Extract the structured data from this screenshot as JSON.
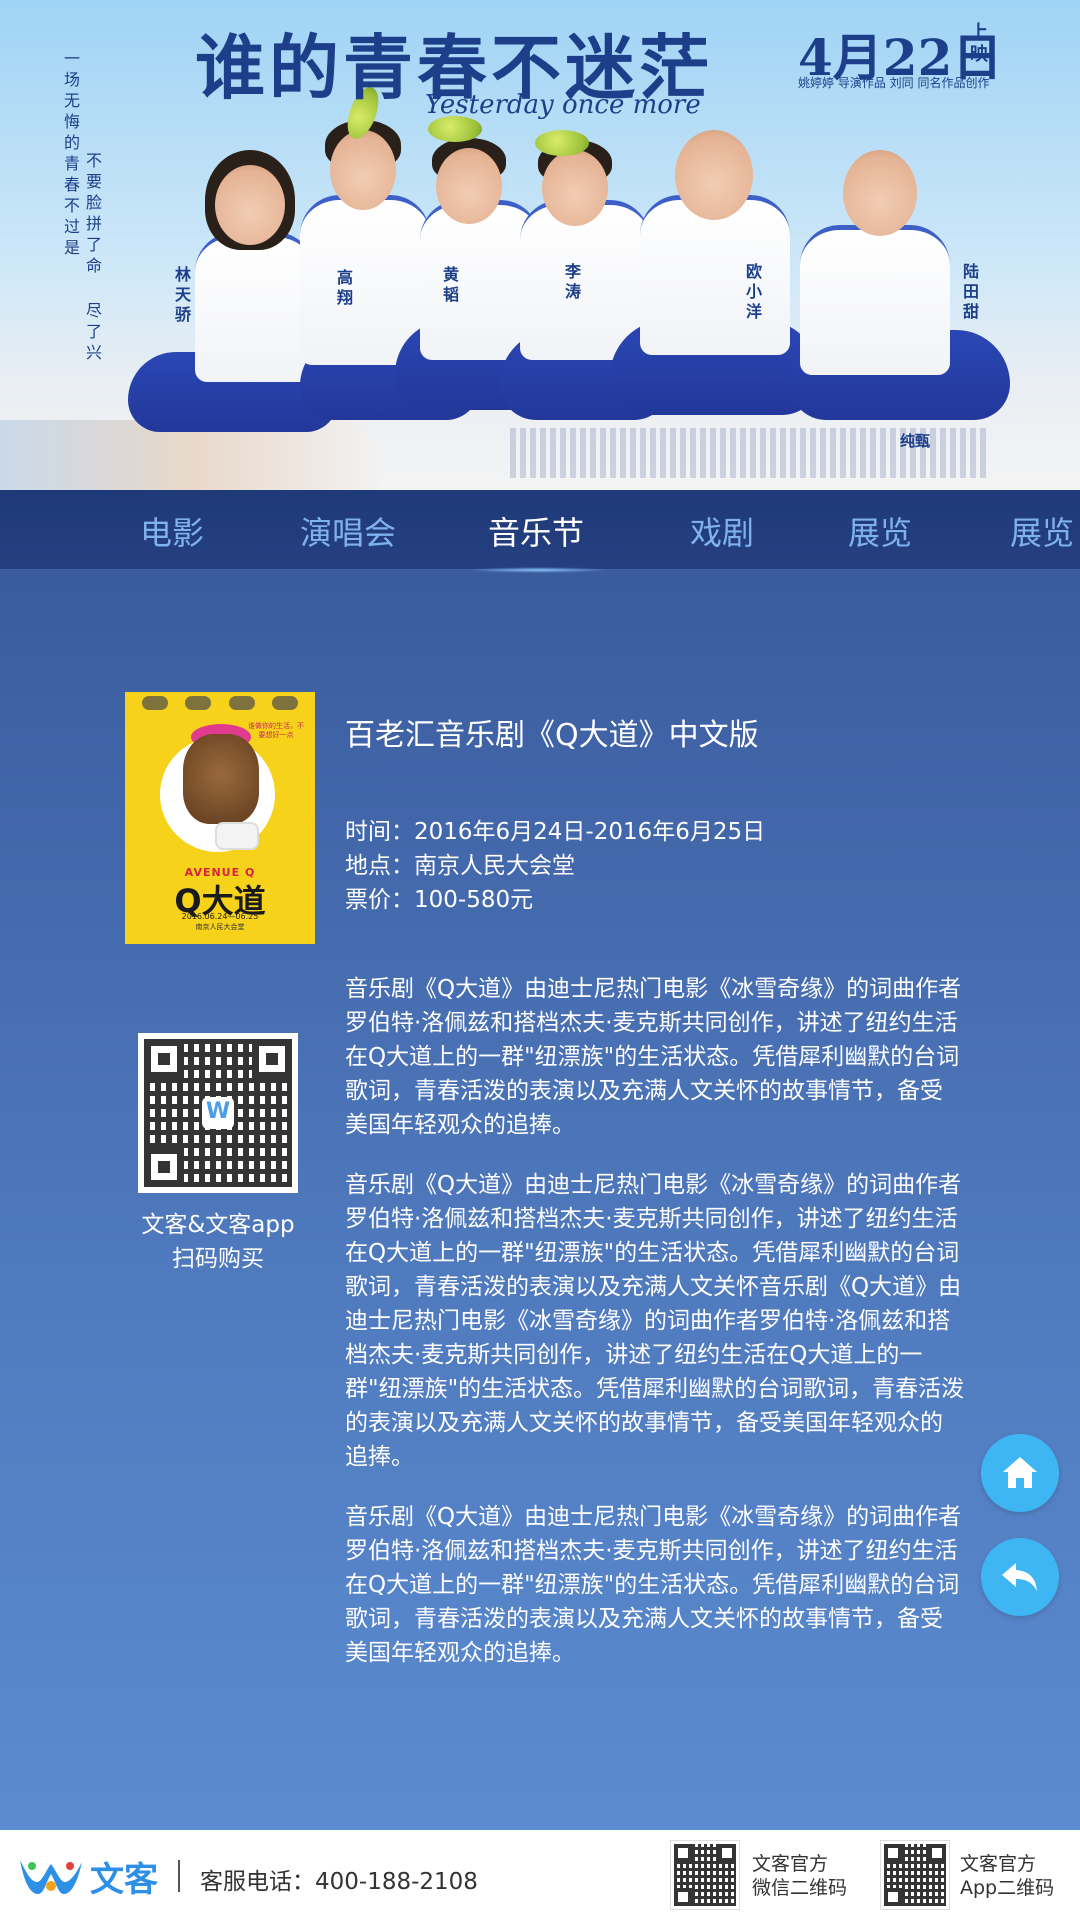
{
  "banner": {
    "title": "谁的青春不迷茫",
    "subtitle": "Yesterday once more",
    "date": "4月22日",
    "date_suffix": "上映",
    "credits": "姚婷婷 导演作品  刘同 同名作品创作",
    "tagline_right": "一场无悔的青春不过是",
    "tagline_mid": "不要脸拼了命",
    "tagline_left": "尽了兴",
    "characters": [
      "林天骄",
      "高翔",
      "黄韬",
      "李涛",
      "欧小洋",
      "陆田甜"
    ],
    "brand_mark": "纯甄"
  },
  "tabs": [
    {
      "label": "电影"
    },
    {
      "label": "演唱会"
    },
    {
      "label": "音乐节"
    },
    {
      "label": "戏剧"
    },
    {
      "label": "展览"
    },
    {
      "label": "展览"
    }
  ],
  "active_tab": "音乐节",
  "poster": {
    "avenue": "AVENUE Q",
    "title": "Q大道",
    "date": "2016.06.24—06.25",
    "venue": "南京人民大会堂",
    "speech": "谁做你的生活，不要想好一点"
  },
  "show": {
    "title": "百老汇音乐剧《Q大道》中文版",
    "time": "时间：2016年6月24日-2016年6月25日",
    "place": "地点：南京人民大会堂",
    "price": "票价：100-580元"
  },
  "qr": {
    "caption_line1": "文客&文客app",
    "caption_line2": "扫码购买"
  },
  "descriptions": [
    "音乐剧《Q大道》由迪士尼热门电影《冰雪奇缘》的词曲作者罗伯特·洛佩兹和搭档杰夫·麦克斯共同创作，讲述了纽约生活在Q大道上的一群\"纽漂族\"的生活状态。凭借犀利幽默的台词歌词，青春活泼的表演以及充满人文关怀的故事情节，备受美国年轻观众的追捧。",
    "音乐剧《Q大道》由迪士尼热门电影《冰雪奇缘》的词曲作者罗伯特·洛佩兹和搭档杰夫·麦克斯共同创作，讲述了纽约生活在Q大道上的一群\"纽漂族\"的生活状态。凭借犀利幽默的台词歌词，青春活泼的表演以及充满人文关怀音乐剧《Q大道》由迪士尼热门电影《冰雪奇缘》的词曲作者罗伯特·洛佩兹和搭档杰夫·麦克斯共同创作，讲述了纽约生活在Q大道上的一群\"纽漂族\"的生活状态。凭借犀利幽默的台词歌词，青春活泼的表演以及充满人文关怀的故事情节，备受美国年轻观众的追捧。",
    "音乐剧《Q大道》由迪士尼热门电影《冰雪奇缘》的词曲作者罗伯特·洛佩兹和搭档杰夫·麦克斯共同创作，讲述了纽约生活在Q大道上的一群\"纽漂族\"的生活状态。凭借犀利幽默的台词歌词，青春活泼的表演以及充满人文关怀的故事情节，备受美国年轻观众的追捧。"
  ],
  "fab": {
    "home_icon": "home-icon",
    "back_icon": "back-arrow-icon",
    "color": "#3fb6f4"
  },
  "footer": {
    "logo_text": "文客",
    "phone": "客服电话：400-188-2108",
    "qr1_line1": "文客官方",
    "qr1_line2": "微信二维码",
    "qr2_line1": "文客官方",
    "qr2_line2": "App二维码"
  },
  "colors": {
    "tab_inactive": "#7fb1ee",
    "tab_active": "#ffffff",
    "brand_blue": "#2d8fe6",
    "poster_yellow": "#f7d21b"
  }
}
